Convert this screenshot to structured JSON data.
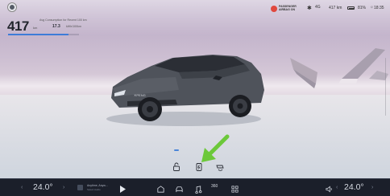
{
  "status": {
    "range_km": "417",
    "range_unit": "km",
    "avg_label": "Avg Consumption for Recent 100 km",
    "avg_value": "17.3",
    "avg_unit": "kWh/100km",
    "range_fill_fraction": 0.85,
    "airbag_text": "PASSENGER AIRBAG ON",
    "signal": "4G",
    "range_right": "417 km",
    "battery_pct": "81%",
    "temp_icon": "☼",
    "time": "18:35"
  },
  "car_controls": [
    {
      "icon": "trunk-icon",
      "active": true
    },
    {
      "icon": "charge-port-icon",
      "active": false
    },
    {
      "icon": "mirror-fold-icon",
      "active": false
    }
  ],
  "dock": {
    "left_temp": "24.0°",
    "right_temp": "24.0°",
    "chev_left": "‹",
    "chev_right": "›",
    "music_title": "Anytime, Anyw...",
    "music_artist": "Select Audio",
    "icons": [
      "car-home-icon",
      "vehicle-settings-icon",
      "music-icon",
      "camera-360-icon",
      "apps-grid-icon"
    ],
    "camera_label": "360",
    "accent": "#4a86d8"
  }
}
